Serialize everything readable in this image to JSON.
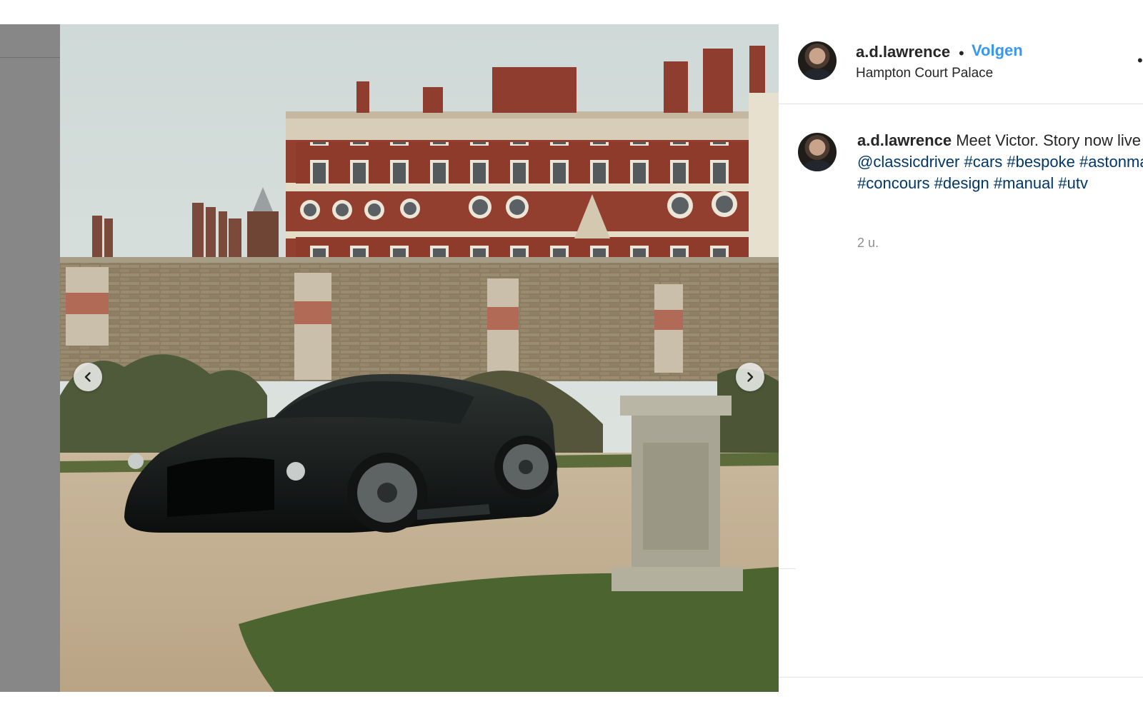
{
  "post": {
    "username": "a.d.lawrence",
    "separator": "•",
    "follow_label": "Volgen",
    "location": "Hampton Court Palace",
    "more_label": "•"
  },
  "caption": {
    "username": "a.d.lawrence",
    "text": "Meet Victor. Story now live on",
    "mention": "@classicdriver",
    "hashtags": [
      "#cars",
      "#bespoke",
      "#astonmartin",
      "#concours",
      "#design",
      "#manual",
      "#utv"
    ],
    "timestamp": "2 u."
  },
  "carousel": {
    "prev_icon": "chevron-left-icon",
    "next_icon": "chevron-right-icon"
  },
  "colors": {
    "link_blue": "#3897f0",
    "hashtag_blue": "#00376b",
    "text_dark": "#262626",
    "text_muted": "#8e8e8e",
    "left_strip_grey": "#878787"
  }
}
